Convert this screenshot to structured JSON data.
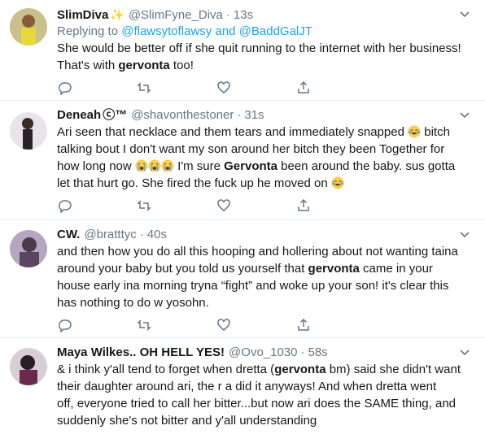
{
  "tweets": [
    {
      "name": "SlimDiva",
      "handle": "@SlimFyne_Diva",
      "time": "13s",
      "reply_prefix": "Replying to ",
      "reply_users": "@flawsytoflawsy and @BaddGalJT",
      "lines": [
        [
          {
            "t": "She would be better off if she quit running to the internet with her business!"
          }
        ],
        [
          {
            "t": "That's with "
          },
          {
            "t": "gervonta",
            "b": true
          },
          {
            "t": " too!"
          }
        ]
      ]
    },
    {
      "name": "Deneah",
      "name_suffix": "™",
      "handle": "@shavonthestoner",
      "time": "31s",
      "lines": [
        [
          {
            "t": "Ari seen that necklace and them tears and immediately snapped "
          },
          {
            "e": "crying"
          },
          {
            "t": " bitch"
          }
        ],
        [
          {
            "t": "talking bout I don't want my son around her bitch they been Together for"
          }
        ],
        [
          {
            "t": "how long now "
          },
          {
            "e": "sob"
          },
          {
            "e": "sob"
          },
          {
            "e": "sob"
          },
          {
            "t": " I'm sure "
          },
          {
            "t": "Gervonta",
            "b": true
          },
          {
            "t": " been around the baby. sus gotta"
          }
        ],
        [
          {
            "t": "let that hurt go. She fired the fuck up he moved on "
          },
          {
            "e": "crying"
          }
        ]
      ]
    },
    {
      "name": "CW.",
      "handle": "@bratttyc",
      "time": "40s",
      "lines": [
        [
          {
            "t": "and then how you do all this hooping and hollering about not wanting taina"
          }
        ],
        [
          {
            "t": "around your baby but you told us yourself that "
          },
          {
            "t": "gervonta",
            "b": true
          },
          {
            "t": " came in your"
          }
        ],
        [
          {
            "t": "house early ina morning tryna “fight” and woke up your son! it's clear this"
          }
        ],
        [
          {
            "t": "has nothing to do w yosohn."
          }
        ]
      ]
    },
    {
      "name": "Maya Wilkes.. OH HELL YES!",
      "handle": "@Ovo_1030",
      "time": "58s",
      "lines": [
        [
          {
            "t": "& i think y'all tend to forget when dretta ("
          },
          {
            "t": "gervonta",
            "b": true
          },
          {
            "t": " bm) said she didn't want"
          }
        ],
        [
          {
            "t": "their daughter around ari, the r    a did it anyways! And when dretta went"
          }
        ],
        [
          {
            "t": "off, everyone tried to call her bitter...but now ari does the SAME thing, and"
          }
        ],
        [
          {
            "t": "suddenly she's not bitter and y'all understanding"
          }
        ]
      ]
    }
  ],
  "actions": [
    "reply-icon",
    "retweet-icon",
    "like-icon",
    "share-icon"
  ],
  "colors": {
    "text": "#14171a",
    "muted": "#657786",
    "link": "#1da1f2",
    "border": "#e6ecf0",
    "icon": "#657786"
  }
}
